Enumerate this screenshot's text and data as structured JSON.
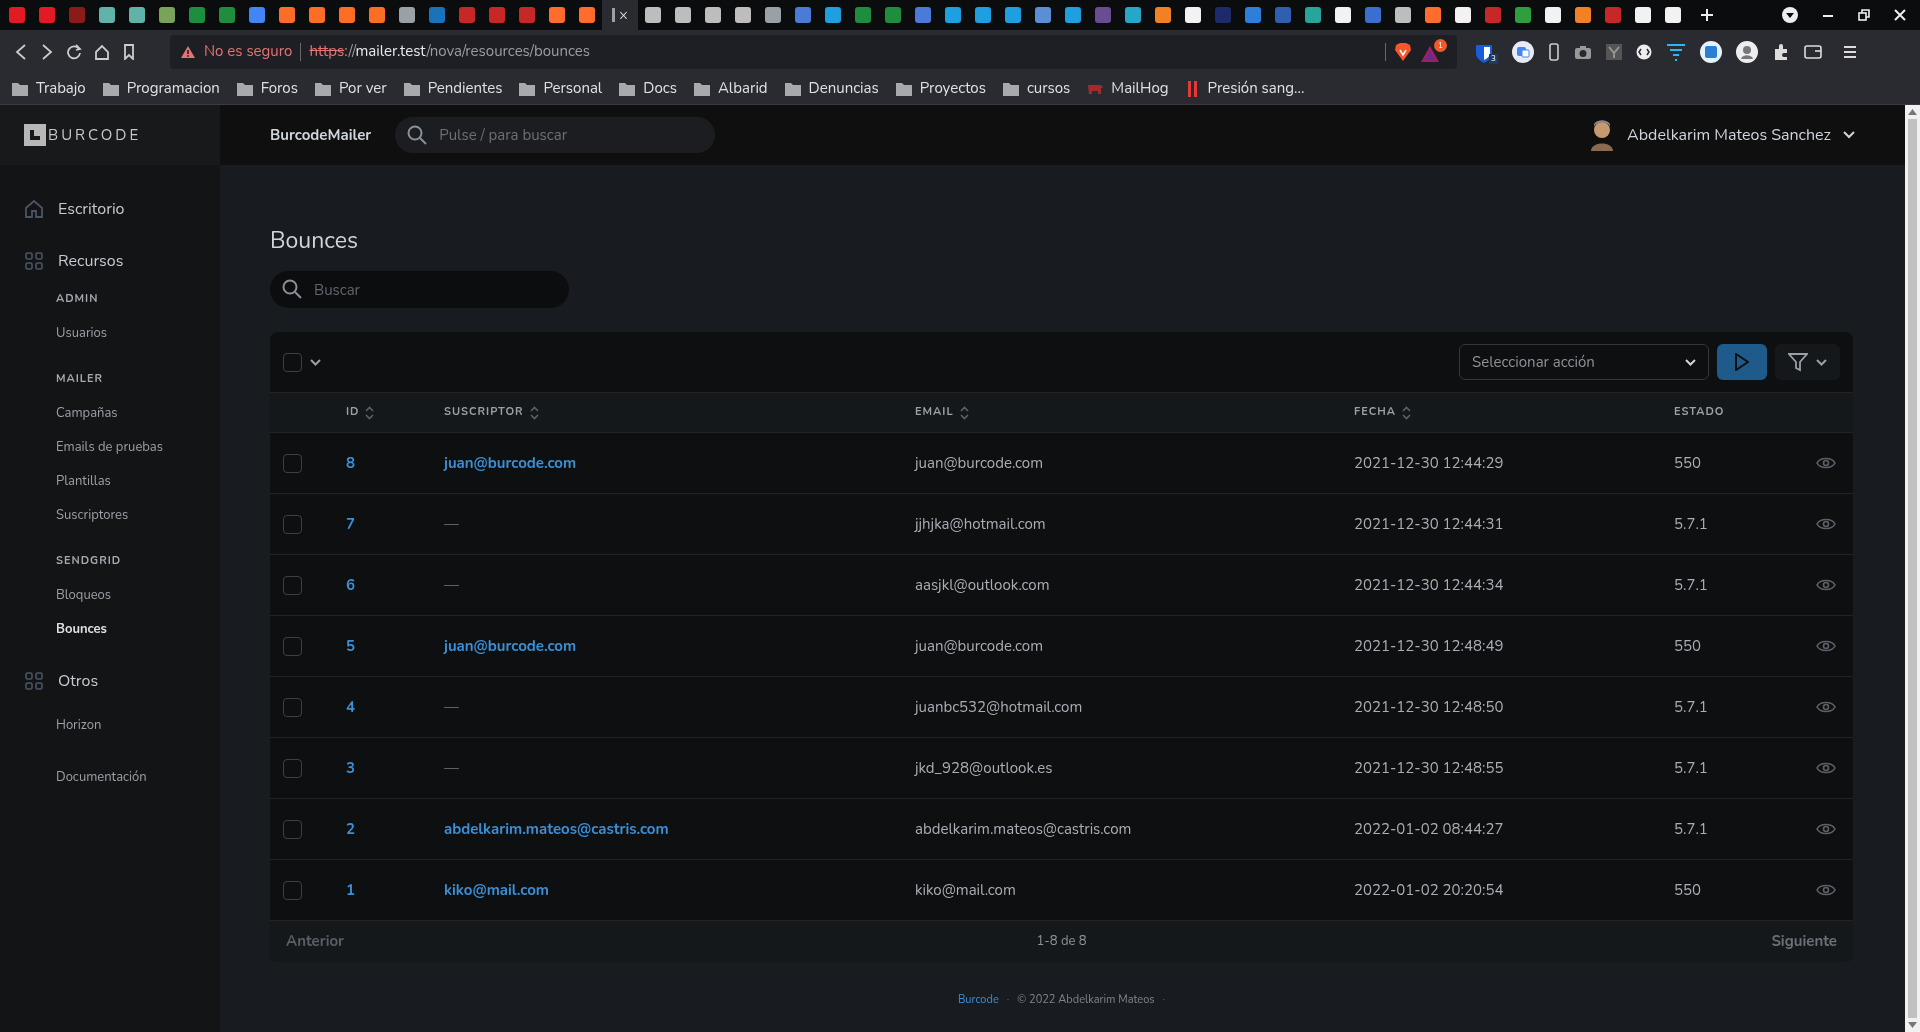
{
  "browser": {
    "tabs": [
      {
        "selected": false,
        "color": "#e01b24"
      },
      {
        "selected": false,
        "color": "#e01b24"
      },
      {
        "selected": false,
        "color": "#8b1a1a"
      },
      {
        "selected": false,
        "color": "#5fb3a8"
      },
      {
        "selected": false,
        "color": "#5fb3a8"
      },
      {
        "selected": false,
        "color": "#7aa35a"
      },
      {
        "selected": false,
        "color": "#1e8e3e"
      },
      {
        "selected": false,
        "color": "#1e8e3e"
      },
      {
        "selected": false,
        "color": "#4285f4"
      },
      {
        "selected": false,
        "color": "#fc6d26"
      },
      {
        "selected": false,
        "color": "#fc6d26"
      },
      {
        "selected": false,
        "color": "#fc6d26"
      },
      {
        "selected": false,
        "color": "#fc6d26"
      },
      {
        "selected": false,
        "color": "#9aa0a6"
      },
      {
        "selected": false,
        "color": "#1a73b8"
      },
      {
        "selected": false,
        "color": "#c62828"
      },
      {
        "selected": false,
        "color": "#c62828"
      },
      {
        "selected": false,
        "color": "#c62828"
      },
      {
        "selected": false,
        "color": "#ff6c2c"
      },
      {
        "selected": false,
        "color": "#ff6c2c"
      },
      {
        "selected": true,
        "color": "#9aa0a6",
        "close": "×"
      },
      {
        "selected": false,
        "color": "#bdbdbd"
      },
      {
        "selected": false,
        "color": "#bdbdbd"
      },
      {
        "selected": false,
        "color": "#bdbdbd"
      },
      {
        "selected": false,
        "color": "#bdbdbd"
      },
      {
        "selected": false,
        "color": "#9aa0a6"
      },
      {
        "selected": false,
        "color": "#4a7bd6"
      },
      {
        "selected": false,
        "color": "#1e9fe0"
      },
      {
        "selected": false,
        "color": "#1e8e3e"
      },
      {
        "selected": false,
        "color": "#1e8e3e"
      },
      {
        "selected": false,
        "color": "#4a7bd6"
      },
      {
        "selected": false,
        "color": "#1e9fe0"
      },
      {
        "selected": false,
        "color": "#1e9fe0"
      },
      {
        "selected": false,
        "color": "#1e9fe0"
      },
      {
        "selected": false,
        "color": "#5a8fd6"
      },
      {
        "selected": false,
        "color": "#1e9fe0"
      },
      {
        "selected": false,
        "color": "#6a4c93"
      },
      {
        "selected": false,
        "color": "#26a6c9"
      },
      {
        "selected": false,
        "color": "#f48024"
      },
      {
        "selected": false,
        "color": "#f2f2f2"
      },
      {
        "selected": false,
        "color": "#1d2a6b"
      },
      {
        "selected": false,
        "color": "#2f7fd8"
      },
      {
        "selected": false,
        "color": "#2f5fb0"
      },
      {
        "selected": false,
        "color": "#26a69a"
      },
      {
        "selected": false,
        "color": "#f2f2f2"
      },
      {
        "selected": false,
        "color": "#3a6fd0"
      },
      {
        "selected": false,
        "color": "#bdbdbd"
      },
      {
        "selected": false,
        "color": "#ff6c2c"
      },
      {
        "selected": false,
        "color": "#f2f2f2"
      },
      {
        "selected": false,
        "color": "#c62828"
      },
      {
        "selected": false,
        "color": "#2e9e3e"
      },
      {
        "selected": false,
        "color": "#f2f2f2"
      },
      {
        "selected": false,
        "color": "#f48024"
      },
      {
        "selected": false,
        "color": "#c62828"
      },
      {
        "selected": false,
        "color": "#f2f2f2"
      },
      {
        "selected": false,
        "color": "#f2f2f2"
      }
    ],
    "address": {
      "warning": "No es seguro",
      "url_parts": [
        {
          "kind": "scheme",
          "text": "https"
        },
        {
          "kind": "plain",
          "text": "://"
        },
        {
          "kind": "host",
          "text": "mailer.test"
        },
        {
          "kind": "plain",
          "text": "/nova/resources/bounces"
        }
      ]
    },
    "extension_badges": [
      "1",
      "3"
    ],
    "bookmarks": [
      {
        "kind": "folder",
        "label": "Trabajo"
      },
      {
        "kind": "folder",
        "label": "Programacion"
      },
      {
        "kind": "folder",
        "label": "Foros"
      },
      {
        "kind": "folder",
        "label": "Por ver"
      },
      {
        "kind": "folder",
        "label": "Pendientes"
      },
      {
        "kind": "folder",
        "label": "Personal"
      },
      {
        "kind": "folder",
        "label": "Docs"
      },
      {
        "kind": "folder",
        "label": "Albarid"
      },
      {
        "kind": "folder",
        "label": "Denuncias"
      },
      {
        "kind": "folder",
        "label": "Proyectos"
      },
      {
        "kind": "folder",
        "label": "cursos"
      },
      {
        "kind": "pig",
        "label": "MailHog"
      },
      {
        "kind": "bars",
        "label": "Presión sang..."
      }
    ]
  },
  "sidebar": {
    "logo": "BURCODE",
    "sections": [
      {
        "kind": "link",
        "label": "Escritorio"
      },
      {
        "kind": "group",
        "label": "Recursos",
        "groups": [
          {
            "heading": "ADMIN",
            "items": [
              {
                "label": "Usuarios",
                "selected": false
              }
            ]
          },
          {
            "heading": "MAILER",
            "items": [
              {
                "label": "Campañas",
                "selected": false
              },
              {
                "label": "Emails de pruebas",
                "selected": false
              },
              {
                "label": "Plantillas",
                "selected": false
              },
              {
                "label": "Suscriptores",
                "selected": false
              }
            ]
          },
          {
            "heading": "SENDGRID",
            "items": [
              {
                "label": "Bloqueos",
                "selected": false
              },
              {
                "label": "Bounces",
                "selected": true
              }
            ]
          }
        ]
      },
      {
        "kind": "group",
        "label": "Otros",
        "groups": [
          {
            "items": [
              {
                "label": "Horizon",
                "selected": false
              }
            ]
          }
        ]
      },
      {
        "kind": "plain",
        "label": "Documentación"
      }
    ]
  },
  "header": {
    "app_name": "BurcodeMailer",
    "search_placeholder": "Pulse / para buscar",
    "user": "Abdelkarim Mateos Sanchez"
  },
  "page": {
    "title": "Bounces",
    "search_placeholder": "Buscar",
    "action_placeholder": "Seleccionar acción",
    "select_all_checked": false,
    "columns": [
      {
        "label": "ID",
        "sortable": true
      },
      {
        "label": "SUSCRIPTOR",
        "sortable": true
      },
      {
        "label": "EMAIL",
        "sortable": true
      },
      {
        "label": "FECHA",
        "sortable": true
      },
      {
        "label": "ESTADO",
        "sortable": false
      }
    ],
    "rows": [
      {
        "checked": false,
        "id": "8",
        "subscriber": "juan@burcode.com",
        "linked": true,
        "email": "juan@burcode.com",
        "date": "2021-12-30 12:44:29",
        "status": "550"
      },
      {
        "checked": false,
        "id": "7",
        "subscriber": "—",
        "linked": false,
        "email": "jjhjka@hotmail.com",
        "date": "2021-12-30 12:44:31",
        "status": "5.7.1"
      },
      {
        "checked": false,
        "id": "6",
        "subscriber": "—",
        "linked": false,
        "email": "aasjkl@outlook.com",
        "date": "2021-12-30 12:44:34",
        "status": "5.7.1"
      },
      {
        "checked": false,
        "id": "5",
        "subscriber": "juan@burcode.com",
        "linked": true,
        "email": "juan@burcode.com",
        "date": "2021-12-30 12:48:49",
        "status": "550"
      },
      {
        "checked": false,
        "id": "4",
        "subscriber": "—",
        "linked": false,
        "email": "juanbc532@hotmail.com",
        "date": "2021-12-30 12:48:50",
        "status": "5.7.1"
      },
      {
        "checked": false,
        "id": "3",
        "subscriber": "—",
        "linked": false,
        "email": "jkd_928@outlook.es",
        "date": "2021-12-30 12:48:55",
        "status": "5.7.1"
      },
      {
        "checked": false,
        "id": "2",
        "subscriber": "abdelkarim.mateos@castris.com",
        "linked": true,
        "email": "abdelkarim.mateos@castris.com",
        "date": "2022-01-02 08:44:27",
        "status": "5.7.1"
      },
      {
        "checked": false,
        "id": "1",
        "subscriber": "kiko@mail.com",
        "linked": true,
        "email": "kiko@mail.com",
        "date": "2022-01-02 20:20:54",
        "status": "550"
      }
    ],
    "pagination": {
      "previous": {
        "label": "Anterior",
        "disabled": true
      },
      "info": "1-8 de 8",
      "next": {
        "label": "Siguiente",
        "disabled": true
      }
    },
    "footer": {
      "link": "Burcode",
      "separator": "·",
      "copyright": "© 2022 Abdelkarim Mateos",
      "trailing": "·"
    }
  }
}
